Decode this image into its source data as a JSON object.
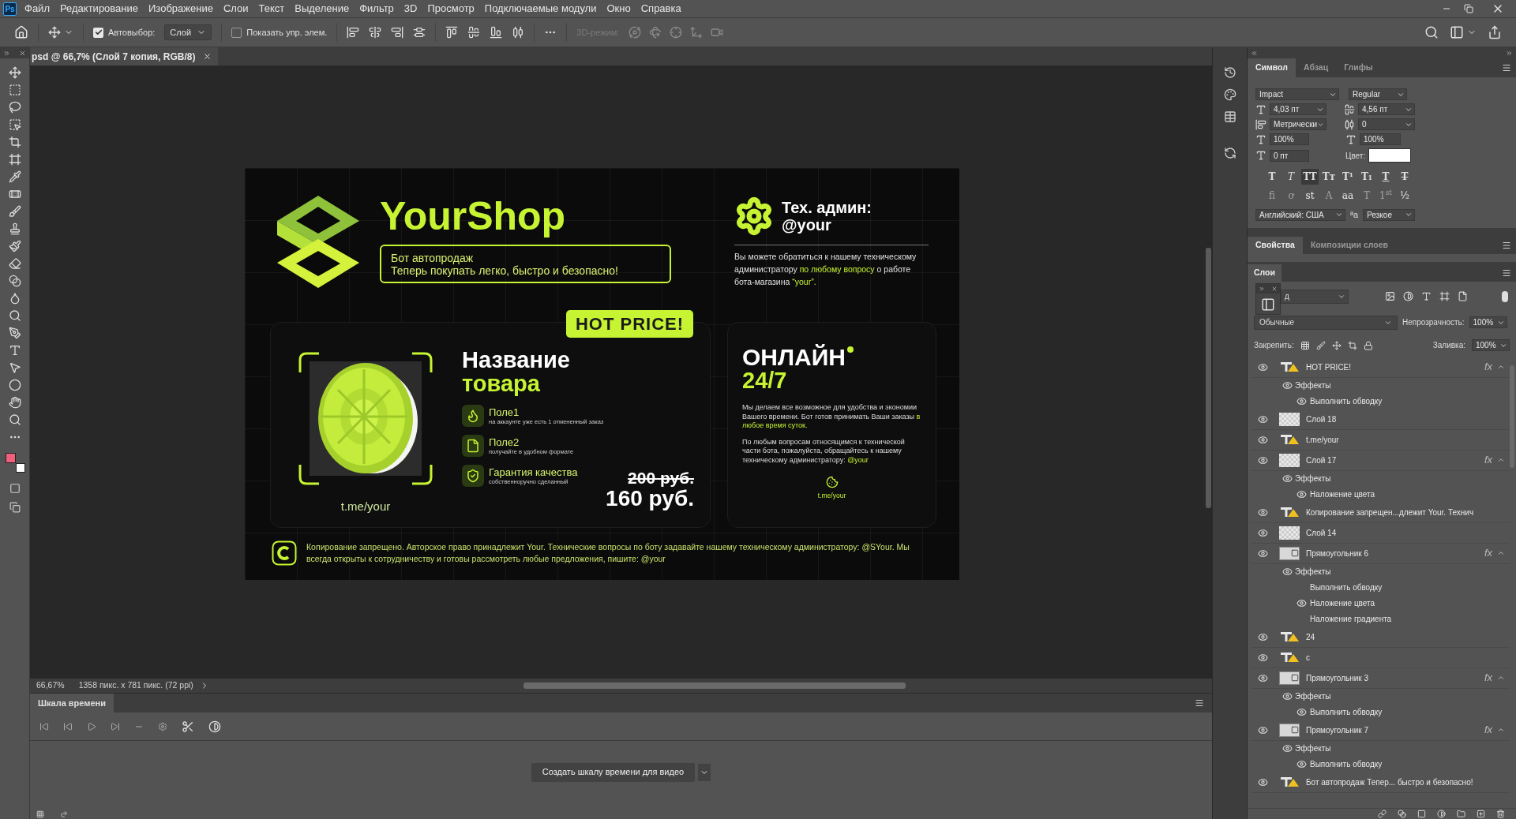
{
  "app_logo": "Ps",
  "menu": [
    "Файл",
    "Редактирование",
    "Изображение",
    "Слои",
    "Текст",
    "Выделение",
    "Фильтр",
    "3D",
    "Просмотр",
    "Подключаемые модули",
    "Окно",
    "Справка"
  ],
  "options_bar": {
    "auto_select": {
      "label": "Автовыбор:",
      "checked": true
    },
    "auto_select_target": "Слой",
    "show_transform": {
      "label": "Показать упр. элем.",
      "checked": false
    },
    "mode_3d": {
      "label": "3D-режим:",
      "disabled": true
    }
  },
  "document_tab": {
    "title": "psd @ 66,7% (Слой 7 копия, RGB/8)"
  },
  "swatches": [
    {
      "color": "#f0607c"
    },
    {
      "color": "#ffffff"
    }
  ],
  "design": {
    "brand": "YourShop",
    "tagline": [
      "Бот автопродаж",
      "Теперь покупать легко, быстро и безопасно!"
    ],
    "admin": {
      "title": "Тех. админ:",
      "handle": "@your",
      "text": [
        {
          "text": "Вы можете обратиться к нашему техническому администратору ",
          "highlight": false
        },
        {
          "text": "по любому вопросу",
          "highlight": true
        },
        {
          "text": " о работе бота-магазина ",
          "highlight": false
        },
        {
          "text": "“your”.",
          "highlight": true
        }
      ]
    },
    "product": {
      "badge": "HOT PRICE!",
      "name": [
        "Название",
        "товара"
      ],
      "link": "t.me/your",
      "features": [
        {
          "kind": "flame",
          "title": "Поле1",
          "subtitle": "на аккаунте уже есть 1 отмененный заказ"
        },
        {
          "kind": "file",
          "title": "Поле2",
          "subtitle": "получайте в удобном формате"
        },
        {
          "kind": "shield",
          "title": "Гарантия качества",
          "subtitle": "собственноручно сделанный"
        }
      ],
      "old_price": "200 руб.",
      "price": "160 руб."
    },
    "online": {
      "title": "ОНЛАЙН",
      "subtitle": "24/7",
      "paragraphs": [
        [
          {
            "text": "Мы делаем все возможное для удобства и экономии Вашего времени. Бот готов принимать Ваши заказы ",
            "highlight": false
          },
          {
            "text": "в любое время суток.",
            "highlight": true
          }
        ],
        [
          {
            "text": "По любым вопросам относящимся к технической части бота, пожалуйста, обращайтесь к нашему техническому администратору: ",
            "highlight": false
          },
          {
            "text": "@your",
            "highlight": true
          }
        ]
      ],
      "link": "t.me/your"
    },
    "footer": "Копирование запрещено. Авторское право принадлежит Your. Технические вопросы по боту задавайте нашему техническому администратору: @SYour. Мы всегда открыты к сотрудничеству и готовы рассмотреть любые предложения, пишите: @your"
  },
  "status_bar": {
    "zoom": "66,67%",
    "size": "1358 пикс. x 781 пикс. (72 ppi)"
  },
  "timeline": {
    "tab": "Шкала времени",
    "create_button": "Создать шкалу времени для видео"
  },
  "character_panel": {
    "tabs": [
      {
        "label": "Символ",
        "selected": true
      },
      {
        "label": "Абзац",
        "selected": false
      },
      {
        "label": "Глифы",
        "selected": false
      }
    ],
    "font_family": "Impact",
    "font_style": "Regular",
    "size": "4,03 пт",
    "leading": "4,56 пт",
    "kerning": "Метрически",
    "tracking": "0",
    "vertical_scale": "100%",
    "horizontal_scale": "100%",
    "baseline_shift": "0 пт",
    "color_label": "Цвет:",
    "color": "#ffffff",
    "style_buttons": [
      {
        "label": "T",
        "kind": "bold",
        "selected": false
      },
      {
        "label": "T",
        "kind": "italic",
        "selected": false
      },
      {
        "label": "TT",
        "kind": "caps",
        "selected": true
      },
      {
        "label": "Tт",
        "kind": "smallcaps",
        "selected": false
      },
      {
        "label": "T¹",
        "kind": "super",
        "selected": false
      },
      {
        "label": "T₁",
        "kind": "sub",
        "selected": false
      },
      {
        "label": "T",
        "kind": "underline",
        "selected": false
      },
      {
        "label": "T",
        "kind": "strike",
        "selected": false
      }
    ],
    "opentype_buttons": [
      {
        "label": "fi",
        "disabled": true
      },
      {
        "label": "ơ",
        "disabled": true
      },
      {
        "label": "st",
        "disabled": false
      },
      {
        "label": "A",
        "disabled": true
      },
      {
        "label": "aa",
        "disabled": false
      },
      {
        "label": "T",
        "disabled": true
      },
      {
        "label": "1$^{st}$",
        "disabled": true
      },
      {
        "label": "½",
        "disabled": false
      }
    ],
    "language": "Английский: США",
    "antialias_icon": "ªa",
    "antialias": "Резкое"
  },
  "properties_tabs": [
    {
      "label": "Свойства",
      "selected": true
    },
    {
      "label": "Композиции слоев",
      "selected": false
    }
  ],
  "layers": {
    "tab": "Слои",
    "filter_kind": "д",
    "blend_mode": "Обычные",
    "opacity_label": "Непрозрачность:",
    "opacity": "100%",
    "lock_label": "Закрепить:",
    "fill_label": "Заливка:",
    "fill": "100%",
    "items": [
      {
        "name": "HOT PRICE!",
        "kind": "text",
        "visible": true,
        "badge": "fx",
        "children": [
          {
            "name": "Эффекты",
            "visible": true,
            "children": [
              {
                "name": "Выполнить обводку",
                "visible": true
              }
            ]
          }
        ]
      },
      {
        "name": "Слой 18",
        "kind": "raster",
        "visible": true
      },
      {
        "name": "t.me/your",
        "kind": "text",
        "visible": true
      },
      {
        "name": "Слой 17",
        "kind": "raster",
        "visible": true,
        "badge": "fx",
        "children": [
          {
            "name": "Эффекты",
            "visible": true,
            "children": [
              {
                "name": "Наложение цвета",
                "visible": true
              }
            ]
          }
        ]
      },
      {
        "name": "Копирование запрещен...длежит Your. Технич",
        "kind": "text",
        "visible": true
      },
      {
        "name": "Слой 14",
        "kind": "raster",
        "visible": true
      },
      {
        "name": "Прямоугольник 6",
        "kind": "shape",
        "visible": true,
        "badge": "fx",
        "children": [
          {
            "name": "Эффекты",
            "visible": true,
            "children": [
              {
                "name": "Выполнить обводку",
                "visible": false
              },
              {
                "name": "Наложение цвета",
                "visible": true
              },
              {
                "name": "Наложение градиента",
                "visible": false
              }
            ]
          }
        ]
      },
      {
        "name": "24",
        "kind": "text",
        "visible": true
      },
      {
        "name": "с",
        "kind": "text",
        "visible": true
      },
      {
        "name": "Прямоугольник 3",
        "kind": "shape",
        "visible": true,
        "badge": "fx",
        "children": [
          {
            "name": "Эффекты",
            "visible": true,
            "children": [
              {
                "name": "Выполнить обводку",
                "visible": true
              }
            ]
          }
        ]
      },
      {
        "name": "Прямоугольник 7",
        "kind": "shape",
        "visible": true,
        "badge": "fx",
        "children": [
          {
            "name": "Эффекты",
            "visible": true,
            "children": [
              {
                "name": "Выполнить обводку",
                "visible": true
              }
            ]
          }
        ]
      },
      {
        "name": "Бот автопродаж  Тепер... быстро и безопасно!",
        "kind": "text",
        "visible": true
      }
    ]
  }
}
